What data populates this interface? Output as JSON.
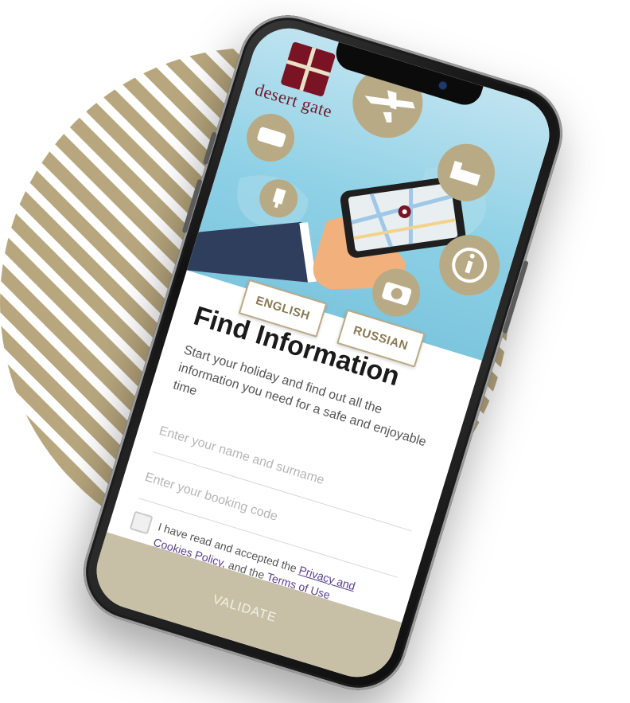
{
  "brand": {
    "logo_text": "desert gate"
  },
  "hero": {
    "icons": [
      "plane-icon",
      "bus-icon",
      "bed-icon",
      "key-icon",
      "info-icon",
      "camera-icon",
      "map-pin-icon"
    ]
  },
  "languages": [
    {
      "label": "ENGLISH"
    },
    {
      "label": "RUSSIAN"
    }
  ],
  "form": {
    "title": "Find Information",
    "subtitle": "Start your holiday and find out all the information you need for a safe and enjoyable time",
    "name_placeholder": "Enter your name and surname",
    "booking_placeholder": "Enter your booking code",
    "consent_prefix": "I have read and accepted the ",
    "privacy_link": "Privacy and Cookies Policy",
    "consent_middle": ", and the ",
    "terms_link": "Terms of Use",
    "validate_label": "VALIDATE"
  },
  "colors": {
    "stripe": "#b8a77e",
    "accent_gold": "#b9aa86",
    "brand_maroon": "#7a1424",
    "validate_bg": "#c8c0a6"
  }
}
